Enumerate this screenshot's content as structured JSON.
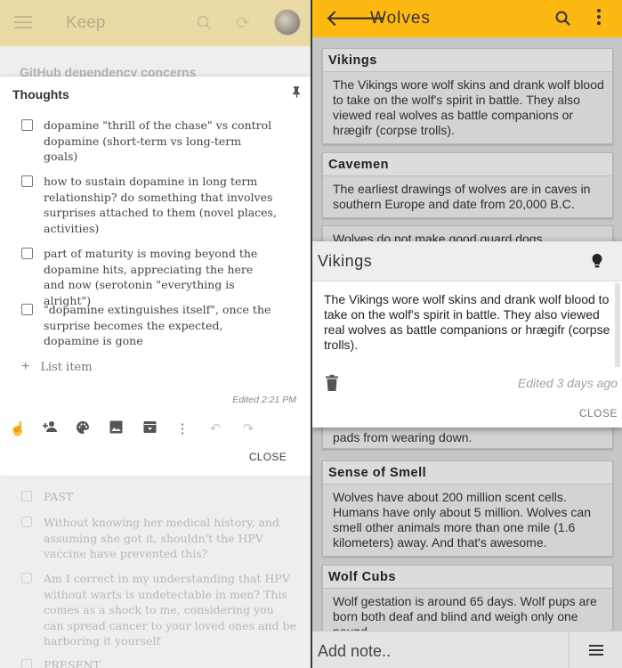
{
  "left": {
    "app_title": "Keep",
    "background_note_title": "GitHub dependency concerns",
    "note": {
      "title": "Thoughts",
      "items": [
        {
          "text": "dopamine \"thrill of the chase\" vs control dopamine (short-term vs long-term goals)",
          "checked": false
        },
        {
          "text": "how to sustain dopamine in long term relationship? do something that involves surprises attached to them (novel places, activities)",
          "checked": false
        },
        {
          "text": "part of maturity is moving beyond the dopamine hits, appreciating the here and now (serotonin \"everything is alright\")",
          "checked": false
        },
        {
          "text": "\"dopamine extinguishes itself\", once the surprise becomes the expected, dopamine is gone",
          "checked": false
        }
      ],
      "add_item_label": "List item",
      "edited": "Edited 2:21 PM",
      "close_label": "CLOSE"
    },
    "background_items": [
      {
        "text": "PAST"
      },
      {
        "text": "Without knowing her medical history, and assuming she got it, shouldn't the HPV vaccine have prevented this?"
      },
      {
        "text": "Am I correct in my understanding that HPV without warts is undetectable in men? This comes as a shock to me, considering you can spread cancer to your loved ones and be harboring it yourself"
      },
      {
        "text": "PRESENT"
      }
    ]
  },
  "right": {
    "app_title": "Wolves",
    "cards": [
      {
        "title": "Vikings",
        "body": "The Vikings wore wolf skins and drank wolf blood to take on the wolf's spirit in battle. They also viewed real wolves as battle companions or hrægifr (corpse trolls)."
      },
      {
        "title": "Cavemen",
        "body": "The earliest drawings of wolves are in caves in southern Europe and date from 20,000 B.C."
      },
      {
        "title": "",
        "body": "Wolves do not make good guard dogs"
      },
      {
        "title": "",
        "body": "pads from wearing down."
      },
      {
        "title": "Sense of Smell",
        "body": "Wolves have about 200 million scent cells. Humans have only about 5 million. Wolves can smell other animals more than one mile (1.6 kilometers) away. And that's awesome."
      },
      {
        "title": "Wolf Cubs",
        "body": "Wolf gestation is around 65 days. Wolf pups are born both deaf and blind and weigh only one pound."
      }
    ],
    "popup": {
      "title": "Vikings",
      "body": "The Vikings wore wolf skins and drank wolf blood to take on the wolf's spirit in battle. They also viewed real wolves as battle companions or hrægifr (corpse trolls).",
      "edited": "Edited 3 days ago",
      "close_label": "CLOSE"
    },
    "add_note_placeholder": "Add note.."
  },
  "colors": {
    "keep_toolbar": "#eadba6",
    "wolves_toolbar": "#fdb811"
  }
}
